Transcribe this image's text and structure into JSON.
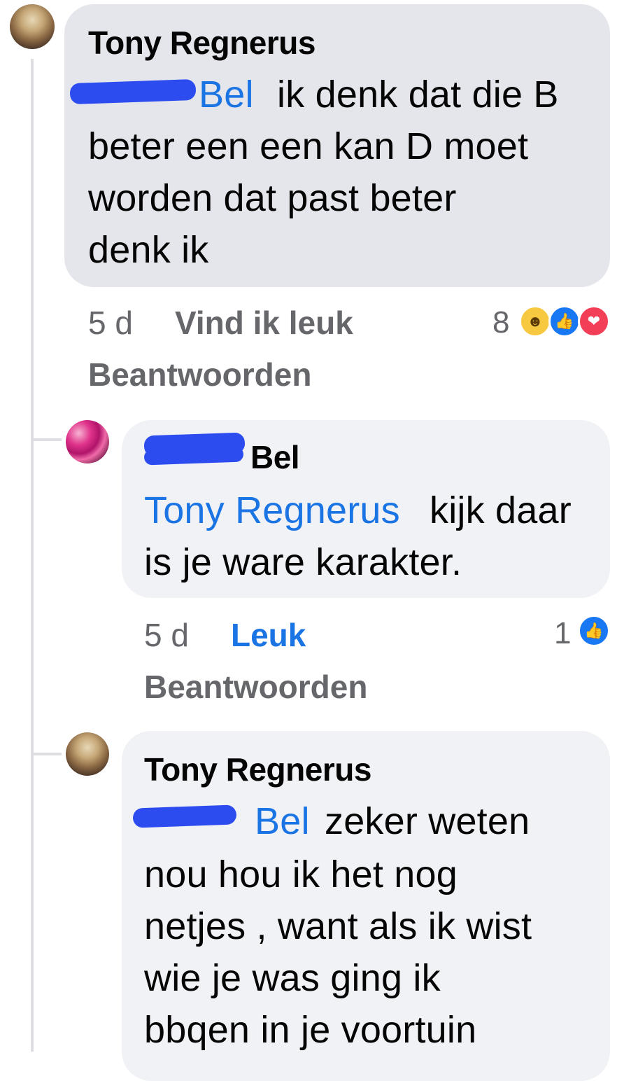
{
  "comments": [
    {
      "author": "Tony Regnerus",
      "mention_visible": "Bel",
      "text_lines": [
        "ik denk dat die B",
        "beter een een kan D moet",
        "worden dat past beter",
        "denk ik"
      ],
      "time": "5 d",
      "like_label": "Vind ik leuk",
      "reply_label": "Beantwoorden",
      "reaction_count": "8",
      "reactions": [
        "haha-icon",
        "like-icon",
        "love-icon"
      ]
    },
    {
      "author_visible": "Bel",
      "mention": "Tony Regnerus",
      "text_first": "kijk daar",
      "text_second": "is je ware karakter.",
      "time": "5 d",
      "like_label": "Leuk",
      "reply_label": "Beantwoorden",
      "reaction_count": "1",
      "reactions": [
        "like-icon"
      ]
    },
    {
      "author": "Tony Regnerus",
      "mention_visible": "Bel",
      "text_first": "zeker weten",
      "text_lines": [
        "nou hou ik het nog",
        "netjes , want als ik wist",
        "wie je was ging ik",
        "bbqen in je voortuin"
      ]
    }
  ],
  "colors": {
    "mention": "#1b74e4",
    "bubble": "#f0f2f5",
    "meta": "#65676b",
    "redaction": "#2d4cf0"
  }
}
